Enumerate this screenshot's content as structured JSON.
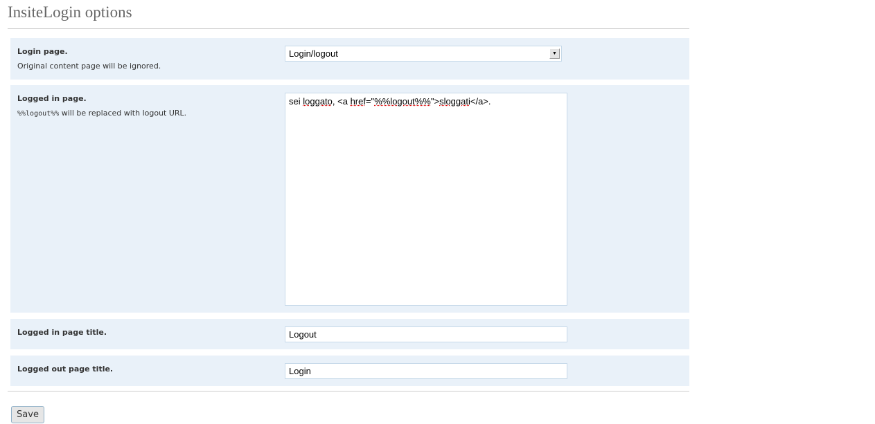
{
  "title": "InsiteLogin options",
  "rows": [
    {
      "label": "Login page.",
      "description": "Original content page will be ignored.",
      "value": "Login/logout"
    },
    {
      "label": "Logged in page.",
      "description_code": "%%logout%%",
      "description": " will be replaced with logout URL.",
      "value_parts": [
        "sei ",
        "loggato",
        ", <a ",
        "href",
        "=\"",
        "%%logout%%",
        "\">",
        "sloggati",
        "</a>."
      ]
    },
    {
      "label": "Logged in page title.",
      "value": "Logout"
    },
    {
      "label": "Logged out page title.",
      "value": "Login"
    }
  ],
  "save_label": "Save"
}
